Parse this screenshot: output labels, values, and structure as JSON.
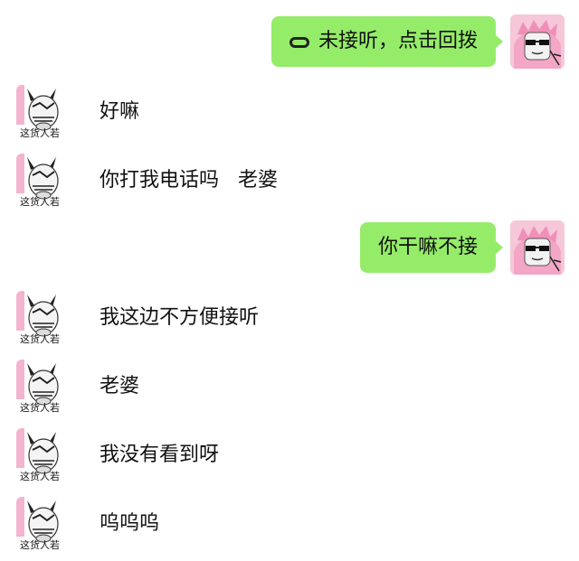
{
  "messages": [
    {
      "side": "right",
      "text": "未接听，点击回拨",
      "icon": "missed-call-icon"
    },
    {
      "side": "left",
      "text": "好嘛"
    },
    {
      "side": "left",
      "text": "你打我电话吗   老婆"
    },
    {
      "side": "right",
      "text": "你干嘛不接"
    },
    {
      "side": "left",
      "text": "我这边不方便接听"
    },
    {
      "side": "left",
      "text": "老婆"
    },
    {
      "side": "left",
      "text": "我没有看到呀"
    },
    {
      "side": "left",
      "text": "呜呜呜"
    }
  ],
  "avatar_labels": {
    "left": "这货人若"
  },
  "colors": {
    "outgoing_bubble": "#95ec69",
    "incoming_bubble": "#ffffff",
    "background": "#ffffff"
  }
}
